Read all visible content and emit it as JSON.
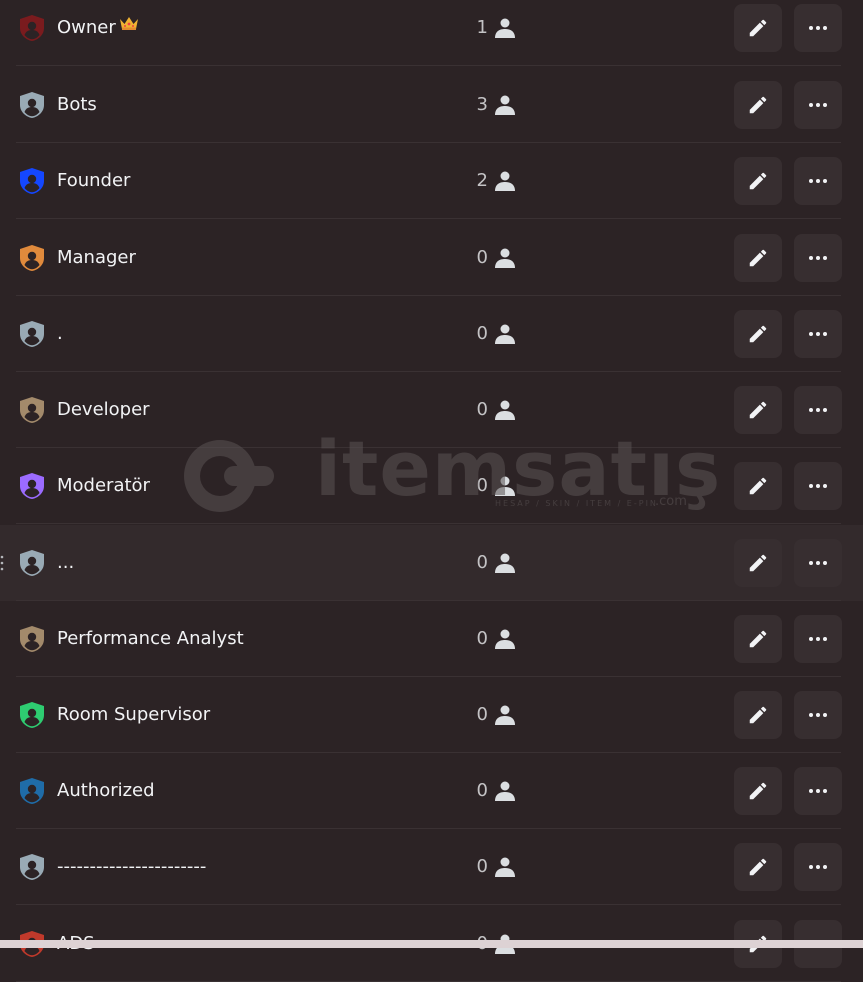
{
  "roles": [
    {
      "name": "Owner",
      "count": "1",
      "color": "#7a1b1e",
      "crown": true
    },
    {
      "name": "Bots",
      "count": "3",
      "color": "#99aab5"
    },
    {
      "name": "Founder",
      "count": "2",
      "color": "#1447ff"
    },
    {
      "name": "Manager",
      "count": "0",
      "color": "#e08a3c"
    },
    {
      "name": ".",
      "count": "0",
      "color": "#99aab5"
    },
    {
      "name": "Developer",
      "count": "0",
      "color": "#a38a6b"
    },
    {
      "name": "Moderatör",
      "count": "0",
      "color": "#9b6bff"
    },
    {
      "name": "...",
      "count": "0",
      "color": "#99aab5",
      "hovered": true
    },
    {
      "name": "Performance Analyst",
      "count": "0",
      "color": "#a38a6b"
    },
    {
      "name": "Room Supervisor",
      "count": "0",
      "color": "#2ecc71"
    },
    {
      "name": "Authorized",
      "count": "0",
      "color": "#1f6ca8"
    },
    {
      "name": "-----------------------",
      "count": "0",
      "color": "#99aab5"
    },
    {
      "name": "ADS",
      "count": "0",
      "color": "#c0392b"
    }
  ],
  "icons": {
    "role": "shield-user-icon",
    "members": "person-icon",
    "edit": "pencil-icon",
    "more": "more-horizontal-icon"
  },
  "watermark": {
    "brand": "itemsatış",
    "tagline": "HESAP / SKIN / ITEM / E-PIN",
    "domain": ".com"
  }
}
